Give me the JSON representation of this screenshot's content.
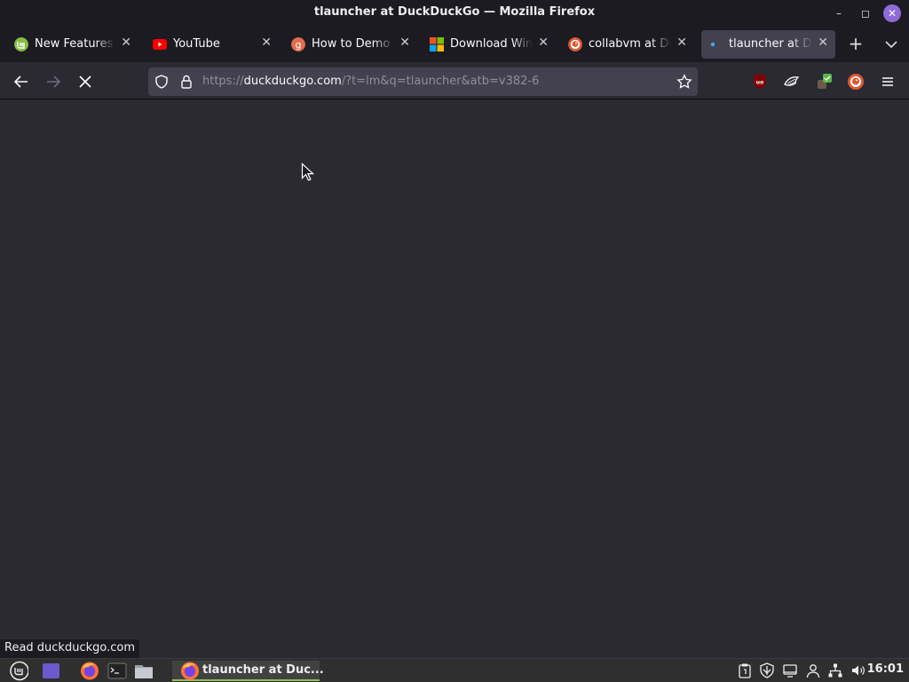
{
  "window": {
    "title": "tlauncher at DuckDuckGo — Mozilla Firefox",
    "controls": {
      "minimize": "–",
      "maximize": "◻",
      "close": "✕"
    }
  },
  "tabs": [
    {
      "label": "New Features in",
      "favicon": "linux-mint-icon",
      "active": false
    },
    {
      "label": "YouTube",
      "favicon": "youtube-icon",
      "active": false
    },
    {
      "label": "How to Demo W",
      "favicon": "g-icon",
      "active": false
    },
    {
      "label": "Download Wind",
      "favicon": "microsoft-icon",
      "active": false
    },
    {
      "label": "collabvm at Duck",
      "favicon": "duckduckgo-icon",
      "active": false
    },
    {
      "label": "tlauncher at Duc",
      "favicon": "loading-icon",
      "active": true
    }
  ],
  "tabstrip": {
    "new_tab": "+",
    "close_glyph": "✕"
  },
  "navbar": {
    "url_scheme": "https://",
    "url_host": "duckduckgo.com",
    "url_rest": "/?t=lm&q=tlauncher&atb=v382-6"
  },
  "status_text": "Read duckduckgo.com",
  "taskbar": {
    "task_label": "tlauncher at Duc...",
    "clock": "16:01"
  },
  "colors": {
    "accent": "#8fbe5b",
    "close_button": "#8e6bd8",
    "background": "#2b2a33"
  }
}
